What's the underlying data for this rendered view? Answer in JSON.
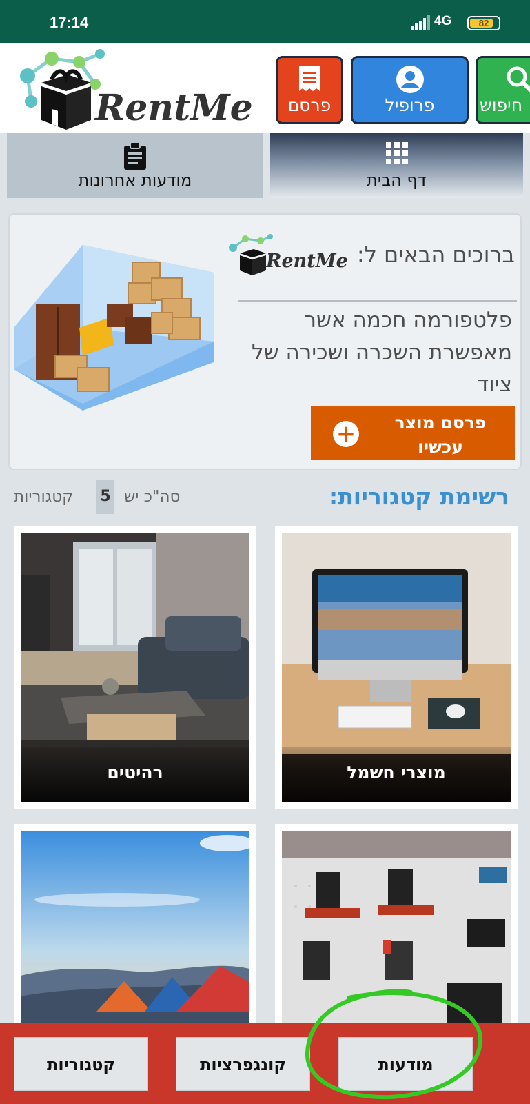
{
  "status_bar": {
    "time": "17:14",
    "network": "4G",
    "battery": "82",
    "battery_fraction": 0.82
  },
  "header": {
    "logo_text": "RentMe",
    "buttons": {
      "publish": "פרסם",
      "profile": "פרופיל",
      "search": "חיפוש"
    }
  },
  "nav": {
    "recent_ads": "מודעות אחרונות",
    "home": "דף הבית"
  },
  "welcome": {
    "title": "ברוכים הבאים ל:",
    "logo_text": "RentMe",
    "description": "פלטפורמה חכמה אשר מאפשרת השכרה ושכירה של ציוד",
    "publish_now": "פרסם מוצר עכשיו"
  },
  "categories": {
    "title": "רשימת קטגוריות:",
    "count_prefix": "סה\"כ יש",
    "count": "5",
    "count_suffix": "קטגוריות",
    "items": [
      {
        "label": "מוצרי חשמל"
      },
      {
        "label": "רהיטים"
      },
      {
        "label": ""
      },
      {
        "label": ""
      }
    ]
  },
  "bottom_nav": {
    "ads": "מודעות",
    "configurations": "קונגפרציות",
    "categories": "קטגוריות"
  },
  "colors": {
    "status_bar": "#0b5e4a",
    "publish": "#e3441e",
    "profile": "#3185dc",
    "search": "#2fb24f",
    "accent_orange": "#d95b00",
    "bottom_bar": "#c8372a",
    "highlight": "#34c924"
  }
}
